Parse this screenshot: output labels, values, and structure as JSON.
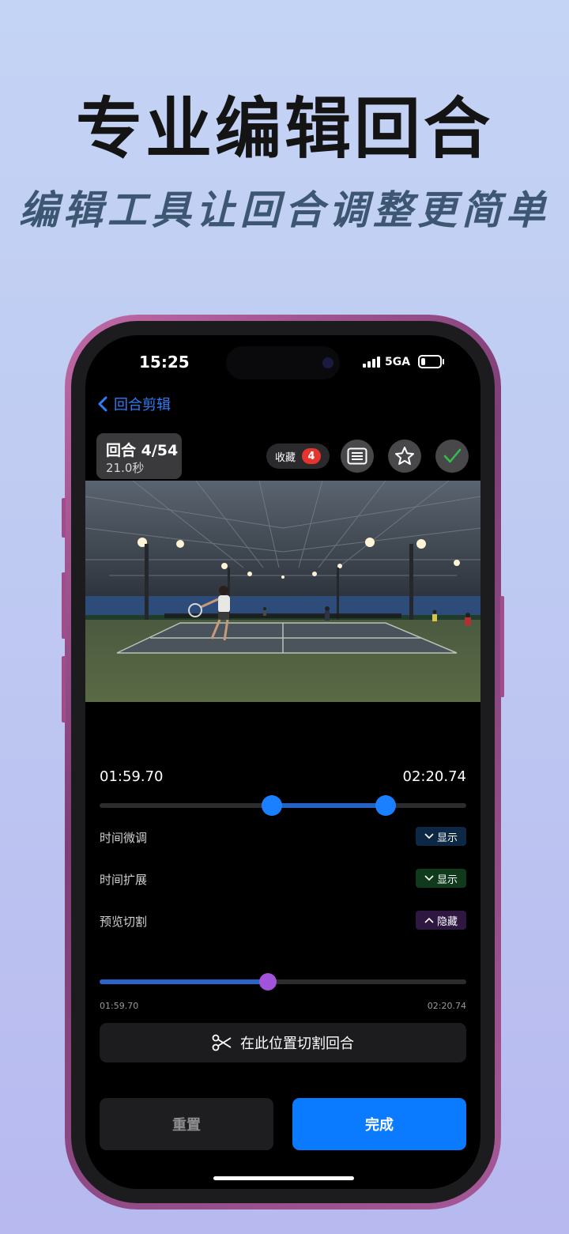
{
  "promo": {
    "headline": "专业编辑回合",
    "subheadline": "编辑工具让回合调整更简单"
  },
  "status_bar": {
    "time": "15:25",
    "network": "5GA",
    "battery_level": 0.3
  },
  "nav": {
    "back_label": "回合剪辑"
  },
  "rally": {
    "title": "回合 4/54",
    "duration": "21.0秒"
  },
  "toolbar": {
    "favorites_label": "收藏",
    "favorites_count": "4",
    "icons": [
      "list-view-icon",
      "star-icon",
      "checkmark-icon"
    ]
  },
  "video": {
    "description_icon": "tennis-court-video-frame"
  },
  "range": {
    "start_time": "01:59.70",
    "end_time": "02:20.74",
    "start_fraction": 0.47,
    "end_fraction": 0.78
  },
  "options": [
    {
      "label": "时间微调",
      "toggle_label": "显示",
      "chevron": "down",
      "bg": "#0d2844",
      "fg": "#ffffff"
    },
    {
      "label": "时间扩展",
      "toggle_label": "显示",
      "chevron": "down",
      "bg": "#0f3a1c",
      "fg": "#ffffff"
    },
    {
      "label": "预览切割",
      "toggle_label": "隐藏",
      "chevron": "up",
      "bg": "#2e1740",
      "fg": "#ffffff"
    }
  ],
  "preview": {
    "start_time": "01:59.70",
    "end_time": "02:20.74",
    "position_fraction": 0.46
  },
  "cut_button": {
    "label": "在此位置切割回合"
  },
  "actions": {
    "reset_label": "重置",
    "done_label": "完成"
  },
  "colors": {
    "accent": "#0a7aff",
    "preview_knob": "#a253dc",
    "badge_red": "#e5342e"
  }
}
